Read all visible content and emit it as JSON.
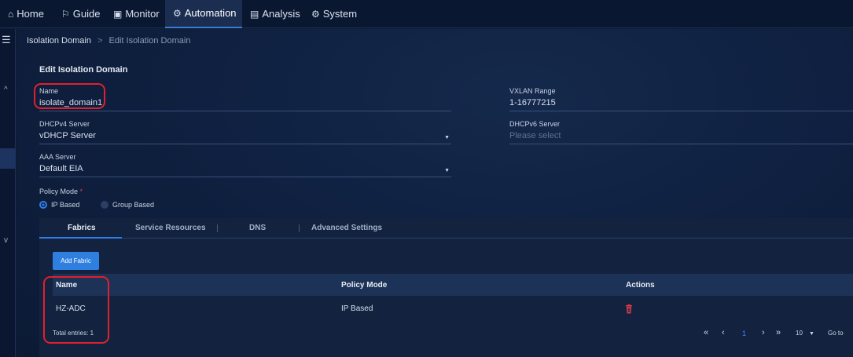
{
  "nav": {
    "items": [
      {
        "label": "Home",
        "icon": "home-icon",
        "glyph": "⌂"
      },
      {
        "label": "Guide",
        "icon": "guide-icon",
        "glyph": "⚐"
      },
      {
        "label": "Monitor",
        "icon": "monitor-icon",
        "glyph": "▣"
      },
      {
        "label": "Automation",
        "icon": "automation-icon",
        "glyph": "⚙"
      },
      {
        "label": "Analysis",
        "icon": "analysis-icon",
        "glyph": "▤"
      },
      {
        "label": "System",
        "icon": "system-icon",
        "glyph": "⚙"
      }
    ],
    "active": "Automation"
  },
  "sidebar": {
    "menu_glyph": "☰",
    "collapse_glyph": "^",
    "expand_glyph": "v"
  },
  "breadcrumb": {
    "root": "Isolation Domain",
    "separator": ">",
    "current": "Edit Isolation Domain"
  },
  "form": {
    "title": "Edit Isolation Domain",
    "name": {
      "label": "Name",
      "value": "isolate_domain1"
    },
    "vxlan": {
      "label": "VXLAN Range",
      "value": "1-16777215"
    },
    "dhcpv4": {
      "label": "DHCPv4 Server",
      "value": "vDHCP Server"
    },
    "dhcpv6": {
      "label": "DHCPv6 Server",
      "placeholder": "Please select"
    },
    "aaa": {
      "label": "AAA Server",
      "value": "Default EIA"
    },
    "policy_mode": {
      "label": "Policy Mode",
      "required_mark": "*",
      "options": [
        "IP Based",
        "Group Based"
      ],
      "selected": "IP Based"
    }
  },
  "tabs": [
    "Fabrics",
    "Service Resources",
    "DNS",
    "Advanced Settings"
  ],
  "active_tab": "Fabrics",
  "add_button": "Add Fabric",
  "table": {
    "columns": [
      "Name",
      "Policy Mode",
      "Actions"
    ],
    "rows": [
      {
        "name": "HZ-ADC",
        "policy_mode": "IP Based"
      }
    ]
  },
  "footer": {
    "total": "Total entries: 1",
    "page": "1",
    "page_size": "10",
    "goto": "Go to",
    "first_glyph": "«",
    "prev_glyph": "‹",
    "next_glyph": "›",
    "last_glyph": "»",
    "dropdown_glyph": "▼"
  },
  "colors": {
    "accent": "#2f80ed",
    "highlight": "#e0202f",
    "danger": "#e03a4a"
  }
}
